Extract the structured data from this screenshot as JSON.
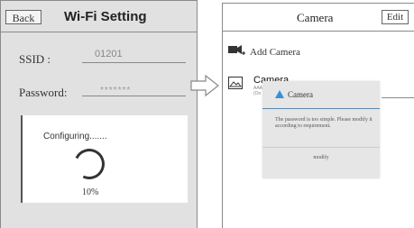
{
  "left_screen": {
    "back_label": "Back",
    "title": "Wi-Fi Setting",
    "ssid_label": "SSID :",
    "ssid_value": "01201",
    "password_label": "Password:",
    "password_value": "*******",
    "config_text": "Configuring.......",
    "progress": "10%"
  },
  "right_screen": {
    "title": "Camera",
    "edit_label": "Edit",
    "add_camera_label": "Add Camera",
    "camera_name": "Camera",
    "camera_sub1": "AAA",
    "camera_sub2": "(On"
  },
  "dialog": {
    "title": "Camera",
    "message": "The password is too simple. Please modify it according to requirement.",
    "modify_label": "modify"
  },
  "colors": {
    "accent": "#3a8fd4",
    "left_bg": "#e1e1e1",
    "dialog_bg": "#e6e6e6"
  }
}
